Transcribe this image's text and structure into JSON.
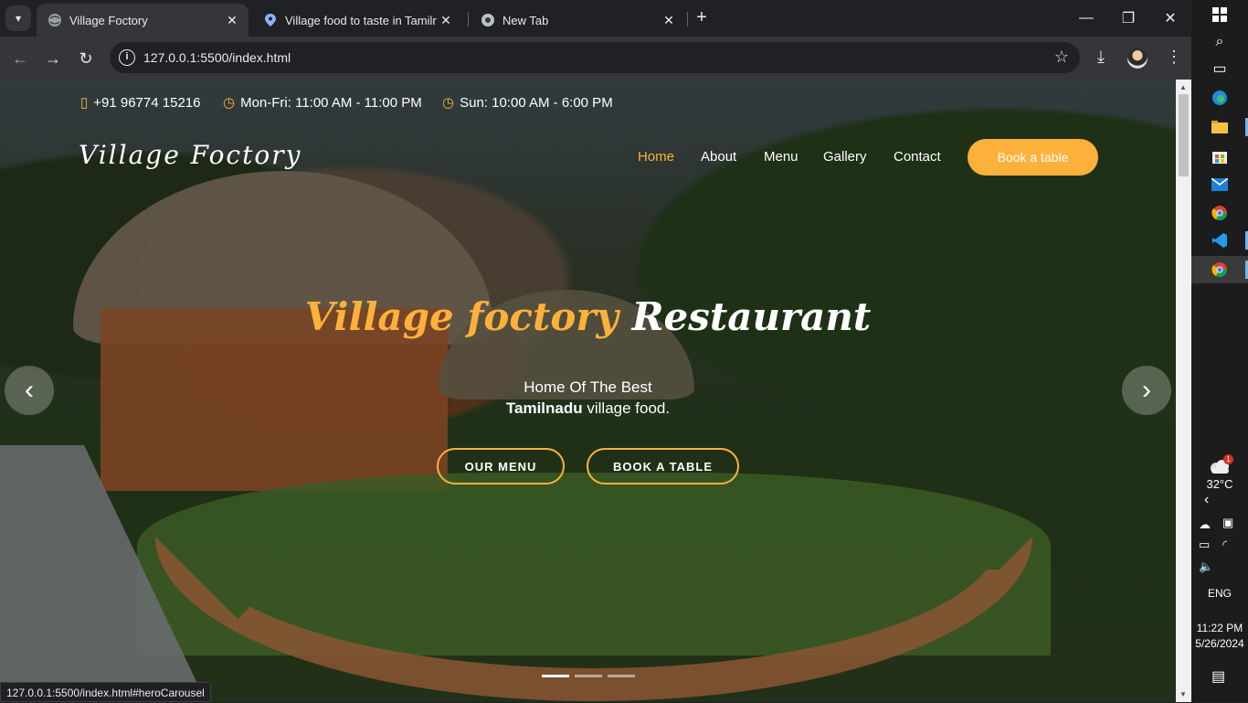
{
  "browser": {
    "tabs": [
      {
        "title": "Village Foctory",
        "active": true
      },
      {
        "title": "Village food to taste in Tamilnadu",
        "active": false
      },
      {
        "title": "New Tab",
        "active": false
      }
    ],
    "url": "127.0.0.1:5500/index.html",
    "status_url": "127.0.0.1:5500/index.html#heroCarousel"
  },
  "site": {
    "contact": {
      "phone": "+91 96774 15216",
      "weekday_hours": "Mon-Fri: 11:00 AM - 11:00 PM",
      "sunday_hours": "Sun: 10:00 AM - 6:00 PM"
    },
    "brand": "Village Foctory",
    "nav": {
      "home": "Home",
      "about": "About",
      "menu": "Menu",
      "gallery": "Gallery",
      "contact": "Contact",
      "book": "Book a table"
    },
    "hero": {
      "title_accent": "Village foctory",
      "title_rest": "Restaurant",
      "subtitle_line1": "Home Of The Best",
      "subtitle_bold": "Tamilnadu",
      "subtitle_rest": " village food.",
      "btn_menu": "OUR MENU",
      "btn_book": "BOOK A TABLE",
      "slide_count": 3,
      "active_slide": 1
    },
    "accent_color": "#feb13a"
  },
  "taskbar": {
    "weather_temp": "32°C",
    "weather_badge": "1",
    "language": "ENG",
    "time": "11:22 PM",
    "date": "5/26/2024"
  }
}
